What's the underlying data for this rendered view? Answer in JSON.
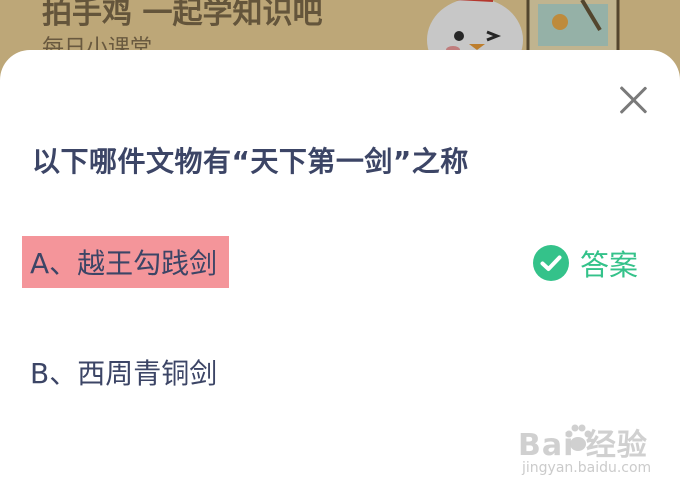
{
  "background": {
    "title": "拍手鸡 一起学知识吧",
    "subtitle": "每日小课堂"
  },
  "dialog": {
    "question": "以下哪件文物有“天下第一剑”之称",
    "options": [
      {
        "label": "A、越王勾践剑",
        "highlighted": true
      },
      {
        "label": "B、西周青铜剑",
        "highlighted": false
      }
    ],
    "answer_label": "答案",
    "close_icon": "close-icon",
    "check_icon": "check-circle-icon"
  },
  "watermark": {
    "brand": "Bai 经验",
    "url": "jingyan.baidu.com"
  },
  "colors": {
    "highlight": "#f4959a",
    "answer_green": "#34c28a",
    "text": "#3c4566"
  }
}
